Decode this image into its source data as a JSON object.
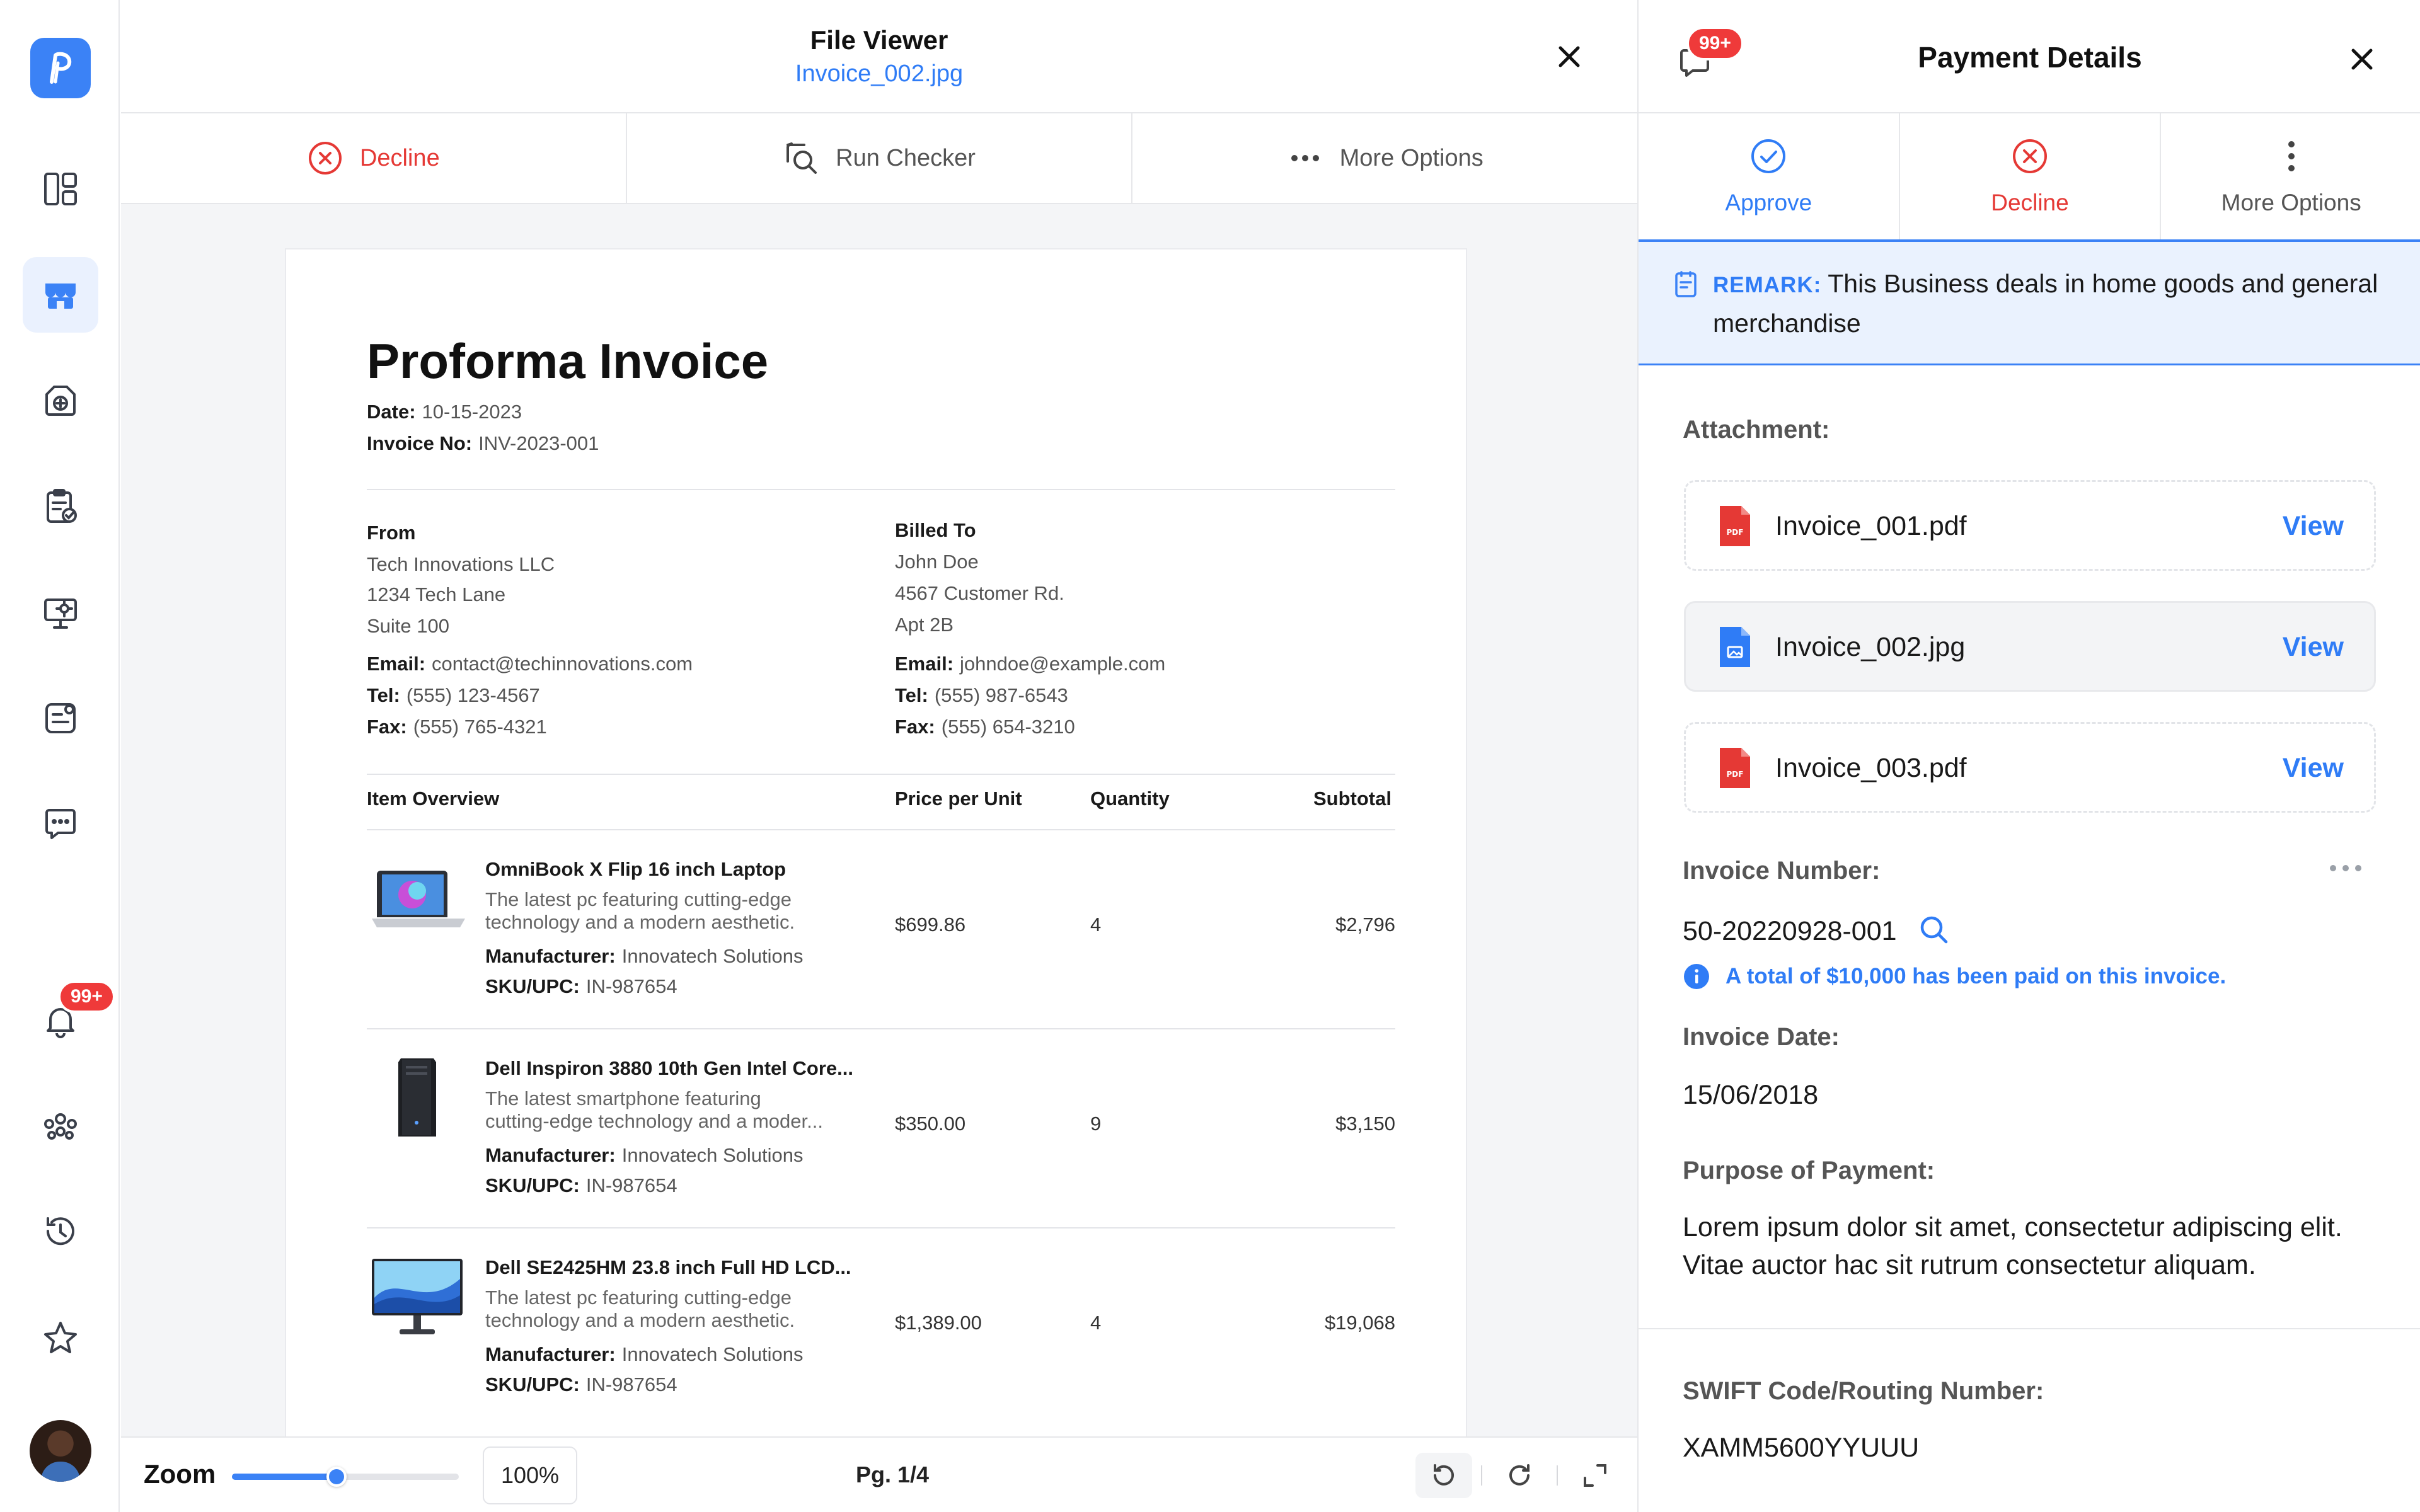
{
  "colors": {
    "accent": "#3b82f6",
    "link": "#2f7cf6",
    "danger": "#e53935",
    "badge": "#ef3a3a"
  },
  "nav": {
    "logo_icon": "app-logo-p",
    "items": [
      {
        "icon": "dashboard-icon"
      },
      {
        "icon": "storefront-icon",
        "active": true
      },
      {
        "icon": "box-plus-icon"
      },
      {
        "icon": "clipboard-check-icon"
      },
      {
        "icon": "monitor-gear-icon"
      },
      {
        "icon": "id-card-icon"
      },
      {
        "icon": "chat-icon"
      },
      {
        "icon": "bell-icon"
      },
      {
        "icon": "team-icon"
      },
      {
        "icon": "history-icon"
      },
      {
        "icon": "star-icon"
      }
    ],
    "notifications_badge": "99+"
  },
  "viewer": {
    "title": "File Viewer",
    "filename": "Invoice_002.jpg",
    "toolbar": {
      "decline": "Decline",
      "run_checker": "Run Checker",
      "more_options": "More Options"
    },
    "footer": {
      "zoom_label": "Zoom",
      "zoom_value": "100%",
      "zoom_fraction": 0.5,
      "page": "Pg. 1/4"
    }
  },
  "invoice": {
    "title": "Proforma Invoice",
    "date_label": "Date:",
    "date": "10-15-2023",
    "number_label": "Invoice No:",
    "number": "INV-2023-001",
    "from": {
      "heading": "From",
      "name": "Tech Innovations LLC",
      "address1": "1234 Tech Lane",
      "address2": "Suite 100",
      "email_label": "Email:",
      "email": "contact@techinnovations.com",
      "tel_label": "Tel:",
      "tel": "(555) 123-4567",
      "fax_label": "Fax:",
      "fax": "(555) 765-4321"
    },
    "billed_to": {
      "heading": "Billed To",
      "name": "John Doe",
      "address1": "4567 Customer Rd.",
      "address2": "Apt 2B",
      "email_label": "Email:",
      "email": "johndoe@example.com",
      "tel_label": "Tel:",
      "tel": "(555) 987-6543",
      "fax_label": "Fax:",
      "fax": "(555) 654-3210"
    },
    "columns": {
      "item": "Item Overview",
      "price": "Price per Unit",
      "qty": "Quantity",
      "subtotal": "Subtotal"
    },
    "items": [
      {
        "name": "OmniBook X Flip 16 inch Laptop",
        "desc1": "The latest pc featuring cutting-edge",
        "desc2": "technology and a modern aesthetic.",
        "manufacturer_label": "Manufacturer:",
        "manufacturer": "Innovatech Solutions",
        "sku_label": "SKU/UPC:",
        "sku": "IN-987654",
        "price": "$699.86",
        "qty": "4",
        "subtotal": "$2,796",
        "thumb": "laptop"
      },
      {
        "name": "Dell Inspiron 3880 10th Gen Intel Core...",
        "desc1": "The latest smartphone featuring",
        "desc2": "cutting-edge technology and a moder...",
        "manufacturer_label": "Manufacturer:",
        "manufacturer": "Innovatech Solutions",
        "sku_label": "SKU/UPC:",
        "sku": "IN-987654",
        "price": "$350.00",
        "qty": "9",
        "subtotal": "$3,150",
        "thumb": "desktop-tower"
      },
      {
        "name": "Dell SE2425HM 23.8 inch Full HD LCD...",
        "desc1": "The latest pc featuring cutting-edge",
        "desc2": "technology and a modern aesthetic.",
        "manufacturer_label": "Manufacturer:",
        "manufacturer": "Innovatech Solutions",
        "sku_label": "SKU/UPC:",
        "sku": "IN-987654",
        "price": "$1,389.00",
        "qty": "4",
        "subtotal": "$19,068",
        "thumb": "monitor"
      }
    ]
  },
  "panel": {
    "title": "Payment Details",
    "chat_badge": "99+",
    "actions": {
      "approve": "Approve",
      "decline": "Decline",
      "more_options": "More Options"
    },
    "remark": {
      "key": "REMARK:",
      "text": "This Business deals in home goods and general merchandise"
    },
    "attachment_label": "Attachment:",
    "attachments": [
      {
        "name": "Invoice_001.pdf",
        "type": "pdf",
        "action": "View"
      },
      {
        "name": "Invoice_002.jpg",
        "type": "image",
        "action": "View",
        "selected": true
      },
      {
        "name": "Invoice_003.pdf",
        "type": "pdf",
        "action": "View"
      }
    ],
    "invoice_number_label": "Invoice Number:",
    "invoice_number": "50-20220928-001",
    "paid_info": "A total of $10,000 has been paid on this invoice.",
    "invoice_date_label": "Invoice Date:",
    "invoice_date": "15/06/2018",
    "purpose_label": "Purpose of Payment:",
    "purpose": "Lorem ipsum dolor sit amet, consectetur adipiscing elit. Vitae auctor hac sit rutrum consectetur aliquam.",
    "swift_label": "SWIFT Code/Routing Number:",
    "swift": "XAMM5600YYUUU"
  }
}
